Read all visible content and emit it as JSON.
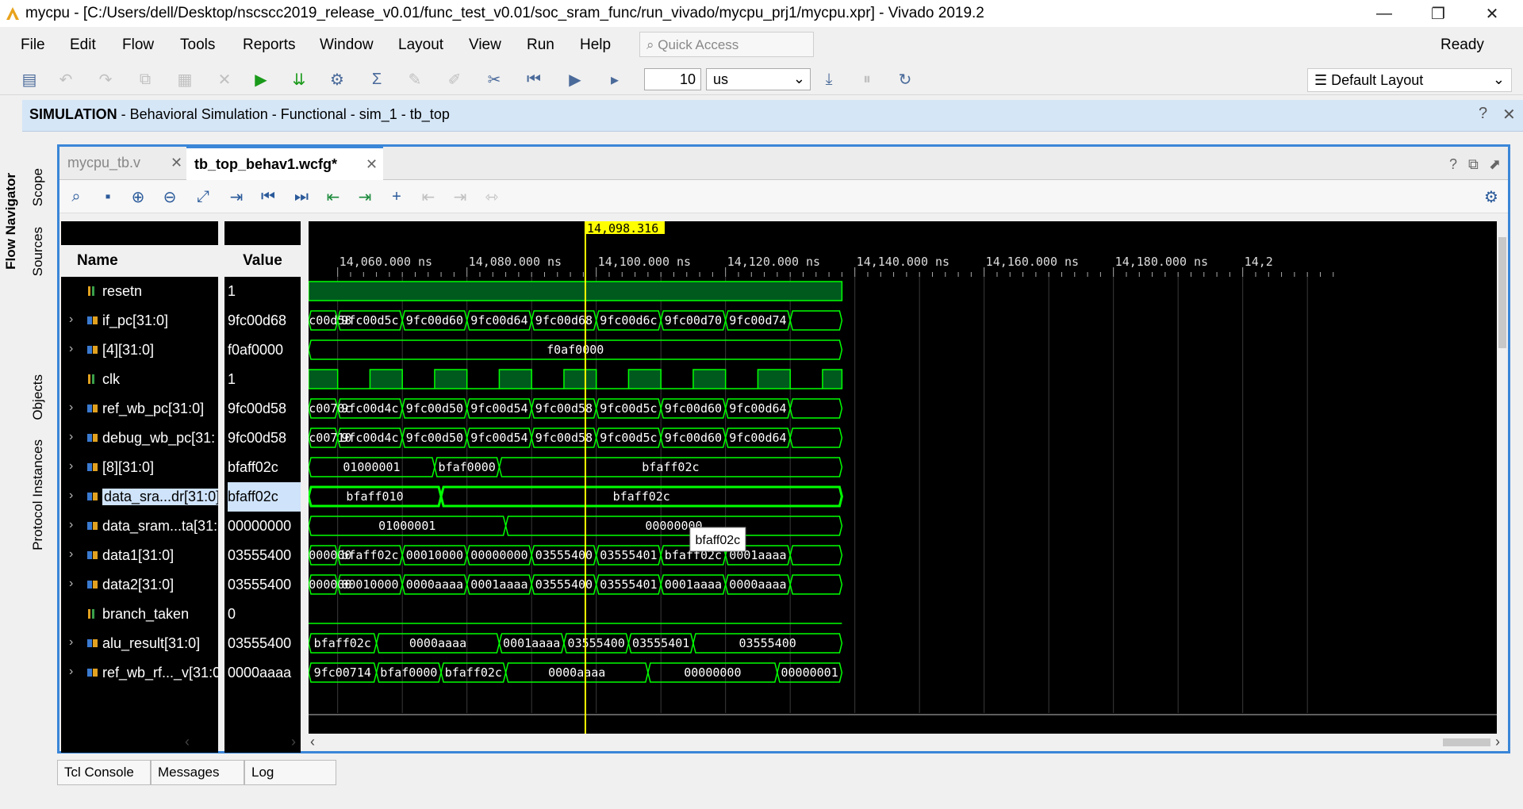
{
  "window": {
    "title": "mycpu - [C:/Users/dell/Desktop/nscscc2019_release_v0.01/func_test_v0.01/soc_sram_func/run_vivado/mycpu_prj1/mycpu.xpr] - Vivado 2019.2",
    "status": "Ready"
  },
  "menu": [
    "File",
    "Edit",
    "Flow",
    "Tools",
    "Reports",
    "Window",
    "Layout",
    "View",
    "Run",
    "Help"
  ],
  "quick_access_placeholder": "Quick Access",
  "toolbar": {
    "run_time_value": "10",
    "run_time_unit": "us",
    "layout_select": "Default Layout"
  },
  "sim_header": {
    "bold": "SIMULATION",
    "rest": " - Behavioral Simulation - Functional - sim_1 - tb_top"
  },
  "side_tabs": {
    "flow_navigator": "Flow Navigator",
    "scope": "Scope",
    "sources": "Sources",
    "objects": "Objects",
    "protocol_instances": "Protocol Instances"
  },
  "file_tabs": [
    {
      "label": "mycpu_tb.v",
      "active": false
    },
    {
      "label": "tb_top_behav1.wcfg*",
      "active": true
    }
  ],
  "columns": {
    "name": "Name",
    "value": "Value"
  },
  "cursor_label": "14,098.316 n",
  "tooltip": "bfaff02c",
  "time_labels": [
    "14,060.000 ns",
    "14,080.000 ns",
    "14,100.000 ns",
    "14,120.000 ns",
    "14,140.000 ns",
    "14,160.000 ns",
    "14,180.000 ns",
    "14,2"
  ],
  "signals": [
    {
      "name": "resetn",
      "value": "1",
      "kind": "bit",
      "expand": false
    },
    {
      "name": "if_pc[31:0]",
      "value": "9fc00d68",
      "kind": "bus",
      "expand": true
    },
    {
      "name": "[4][31:0]",
      "value": "f0af0000",
      "kind": "bus",
      "expand": true
    },
    {
      "name": "clk",
      "value": "1",
      "kind": "bit",
      "expand": false
    },
    {
      "name": "ref_wb_pc[31:0]",
      "value": "9fc00d58",
      "kind": "bus",
      "expand": true
    },
    {
      "name": "debug_wb_pc[31:",
      "value": "9fc00d58",
      "kind": "bus",
      "expand": true
    },
    {
      "name": "[8][31:0]",
      "value": "bfaff02c",
      "kind": "bus",
      "expand": true
    },
    {
      "name": "data_sra...dr[31:0]",
      "value": "bfaff02c",
      "kind": "bus",
      "expand": true,
      "selected": true
    },
    {
      "name": "data_sram...ta[31:",
      "value": "00000000",
      "kind": "bus",
      "expand": true
    },
    {
      "name": "data1[31:0]",
      "value": "03555400",
      "kind": "bus",
      "expand": true
    },
    {
      "name": "data2[31:0]",
      "value": "03555400",
      "kind": "bus",
      "expand": true
    },
    {
      "name": "branch_taken",
      "value": "0",
      "kind": "bit",
      "expand": false
    },
    {
      "name": "alu_result[31:0]",
      "value": "03555400",
      "kind": "bus",
      "expand": true
    },
    {
      "name": "ref_wb_rf..._v[31:0]",
      "value": "0000aaaa",
      "kind": "bus",
      "expand": true
    }
  ],
  "bottom_tabs": [
    "Tcl Console",
    "Messages",
    "Log"
  ],
  "colors": {
    "wave_green": "#00ff00",
    "wave_fill": "#005a1e",
    "cursor": "#ffff00",
    "accent_border": "#3a86d8"
  }
}
